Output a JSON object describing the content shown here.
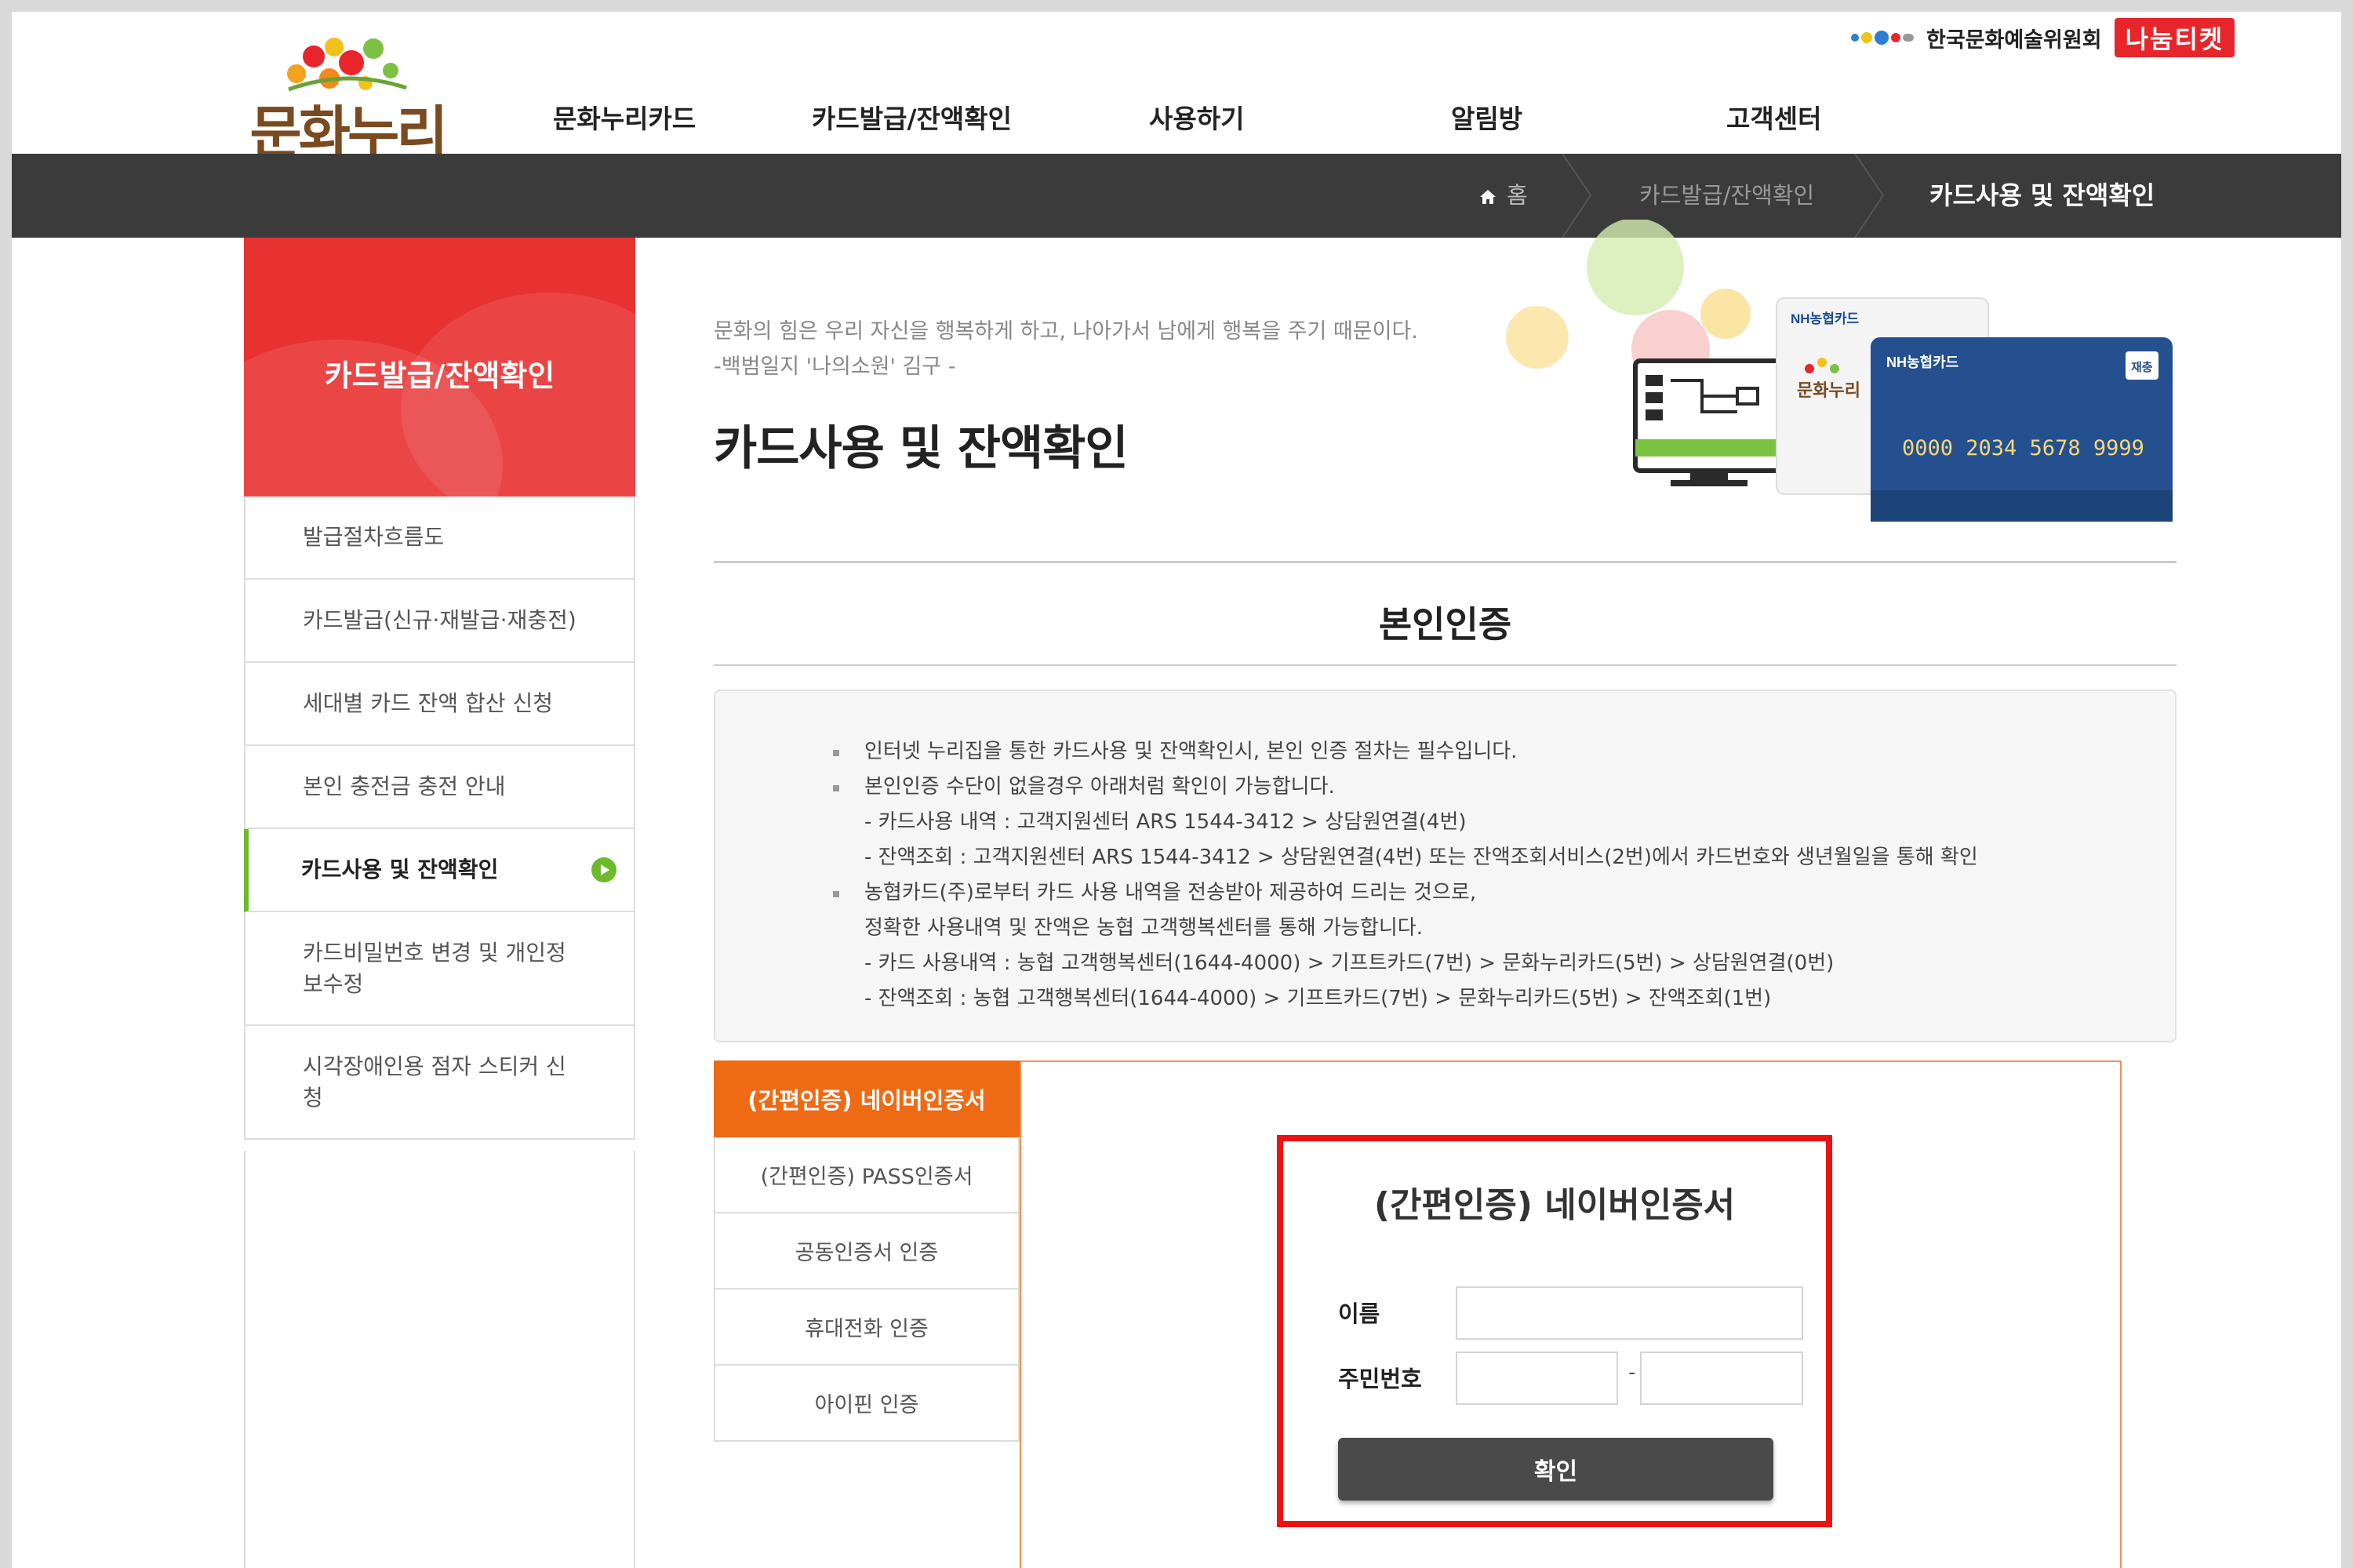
{
  "header": {
    "logo_text": "문화누리",
    "nav": [
      "문화누리카드",
      "카드발급/잔액확인",
      "사용하기",
      "알림방",
      "고객센터"
    ],
    "org_label": "한국문화예술위원회",
    "ticket_badge": "나눔티켓"
  },
  "breadcrumb": {
    "home": "홈",
    "level1": "카드발급/잔액확인",
    "current": "카드사용 및 잔액확인"
  },
  "sidebar": {
    "title": "카드발급/잔액확인",
    "items": [
      {
        "label": "발급절차흐름도"
      },
      {
        "label": "카드발급(신규·재발급·재충전)"
      },
      {
        "label": "세대별 카드 잔액 합산 신청"
      },
      {
        "label": "본인 충전금 충전 안내"
      },
      {
        "label": "카드사용 및 잔액확인",
        "active": true
      },
      {
        "label": "카드비밀번호 변경 및 개인정보수정"
      },
      {
        "label": "시각장애인용 점자 스티커 신청"
      }
    ]
  },
  "content": {
    "quote_line1": "문화의 힘은 우리 자신을 행복하게 하고, 나아가서 남에게 행복을 주기 때문이다.",
    "quote_line2": "-백범일지 '나의소원' 김구 -",
    "page_title": "카드사용 및 잔액확인",
    "section_title": "본인인증",
    "card": {
      "brand": "NH농협카드",
      "number": "0000 2034 5678 9999",
      "tag": "재충",
      "back_logo": "문화누리"
    }
  },
  "notice": {
    "lines": [
      {
        "bullet": true,
        "text": "인터넷 누리집을 통한 카드사용 및 잔액확인시, 본인 인증 절차는 필수입니다."
      },
      {
        "bullet": true,
        "text": "본인인증 수단이 없을경우 아래처럼 확인이 가능합니다."
      },
      {
        "bullet": false,
        "text": "- 카드사용 내역 : 고객지원센터 ARS 1544-3412 > 상담원연결(4번)"
      },
      {
        "bullet": false,
        "text": "- 잔액조회 : 고객지원센터 ARS 1544-3412 > 상담원연결(4번) 또는 잔액조회서비스(2번)에서 카드번호와 생년월일을 통해 확인"
      },
      {
        "bullet": true,
        "text": "농협카드(주)로부터 카드 사용 내역을 전송받아 제공하여 드리는 것으로,"
      },
      {
        "bullet": false,
        "text": "정확한 사용내역 및 잔액은 농협 고객행복센터를 통해 가능합니다."
      },
      {
        "bullet": false,
        "text": "- 카드 사용내역 : 농협 고객행복센터(1644-4000) > 기프트카드(7번) > 문화누리카드(5번) > 상담원연결(0번)"
      },
      {
        "bullet": false,
        "text": "- 잔액조회 : 농협 고객행복센터(1644-4000) > 기프트카드(7번) > 문화누리카드(5번) > 잔액조회(1번)"
      }
    ]
  },
  "auth": {
    "tabs": [
      {
        "label": "(간편인증) 네이버인증서",
        "active": true
      },
      {
        "label": "(간편인증) PASS인증서"
      },
      {
        "label": "공동인증서 인증"
      },
      {
        "label": "휴대전화 인증"
      },
      {
        "label": "아이핀 인증"
      }
    ],
    "form": {
      "title": "(간편인증) 네이버인증서",
      "name_label": "이름",
      "rrn_label": "주민번호",
      "name_value": "",
      "rrn_front_value": "",
      "rrn_back_value": "",
      "rrn_separator": "-",
      "submit_label": "확인"
    }
  },
  "colors": {
    "sidebar_header": "#e83232",
    "active_tab": "#ef6a14",
    "active_marker": "#6fba2c",
    "breadcrumb_bar": "#3b3b3b",
    "highlight_box": "#ee1111",
    "card_navy": "#25508f"
  }
}
